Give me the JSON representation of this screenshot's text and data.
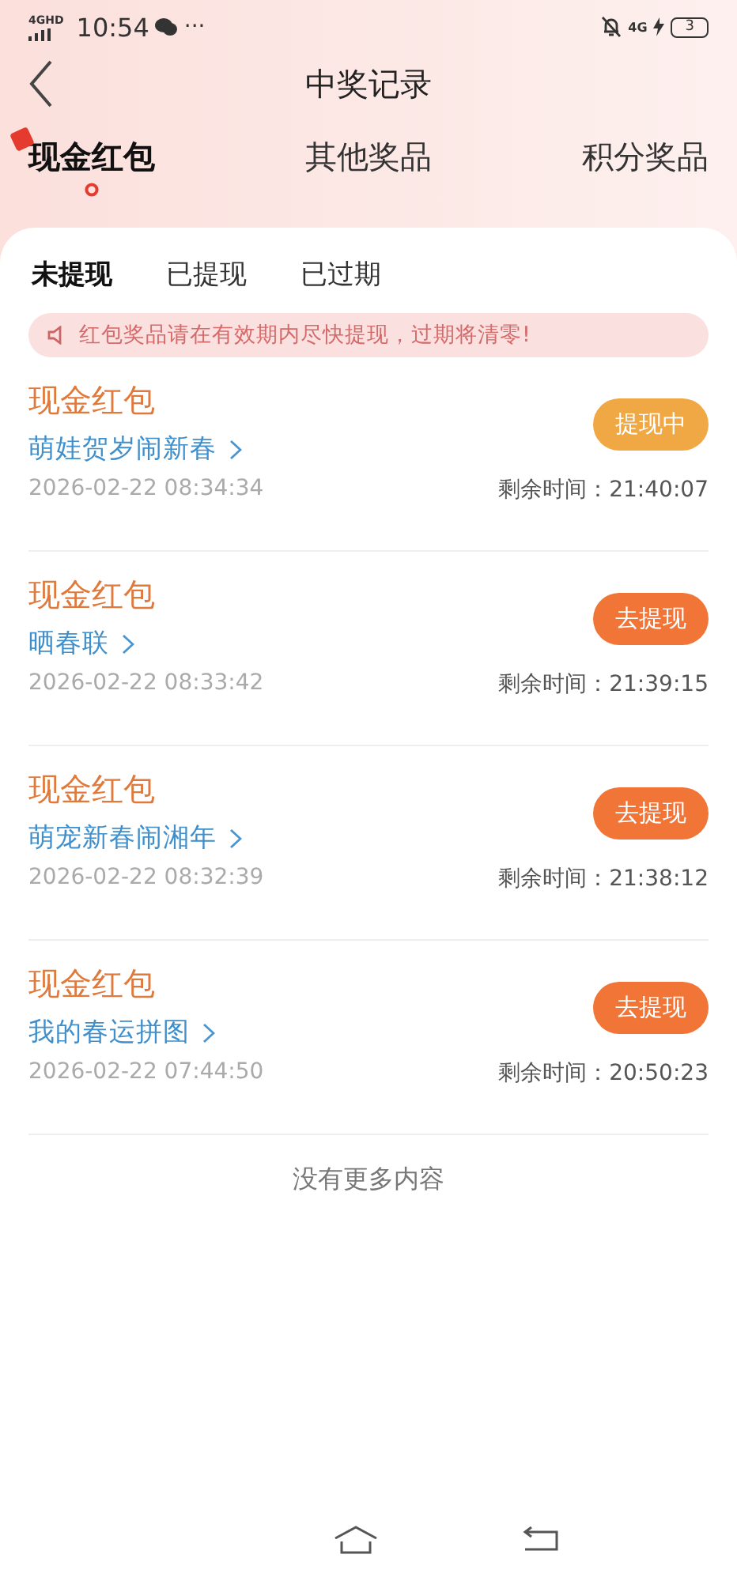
{
  "status_bar": {
    "network": "4GHD",
    "time": "10:54",
    "more": "···",
    "network_right": "4G",
    "battery": "3"
  },
  "header": {
    "title": "中奖记录"
  },
  "tabs": [
    {
      "label": "现金红包",
      "selected": true
    },
    {
      "label": "其他奖品",
      "selected": false
    },
    {
      "label": "积分奖品",
      "selected": false
    }
  ],
  "sub_tabs": [
    {
      "label": "未提现",
      "selected": true
    },
    {
      "label": "已提现",
      "selected": false
    },
    {
      "label": "已过期",
      "selected": false
    }
  ],
  "notice": "红包奖品请在有效期内尽快提现，过期将清零!",
  "records": [
    {
      "title": "现金红包",
      "name": "萌娃贺岁闹新春",
      "date": "2026-02-22 08:34:34",
      "button": {
        "label": "提现中",
        "kind": "pending"
      },
      "remaining": "剩余时间：21:40:07"
    },
    {
      "title": "现金红包",
      "name": "晒春联",
      "date": "2026-02-22 08:33:42",
      "button": {
        "label": "去提现",
        "kind": "withdraw"
      },
      "remaining": "剩余时间：21:39:15"
    },
    {
      "title": "现金红包",
      "name": "萌宠新春闹湘年",
      "date": "2026-02-22 08:32:39",
      "button": {
        "label": "去提现",
        "kind": "withdraw"
      },
      "remaining": "剩余时间：21:38:12"
    },
    {
      "title": "现金红包",
      "name": "我的春运拼图",
      "date": "2026-02-22 07:44:50",
      "button": {
        "label": "去提现",
        "kind": "withdraw"
      },
      "remaining": "剩余时间：20:50:23"
    }
  ],
  "footer": "没有更多内容"
}
